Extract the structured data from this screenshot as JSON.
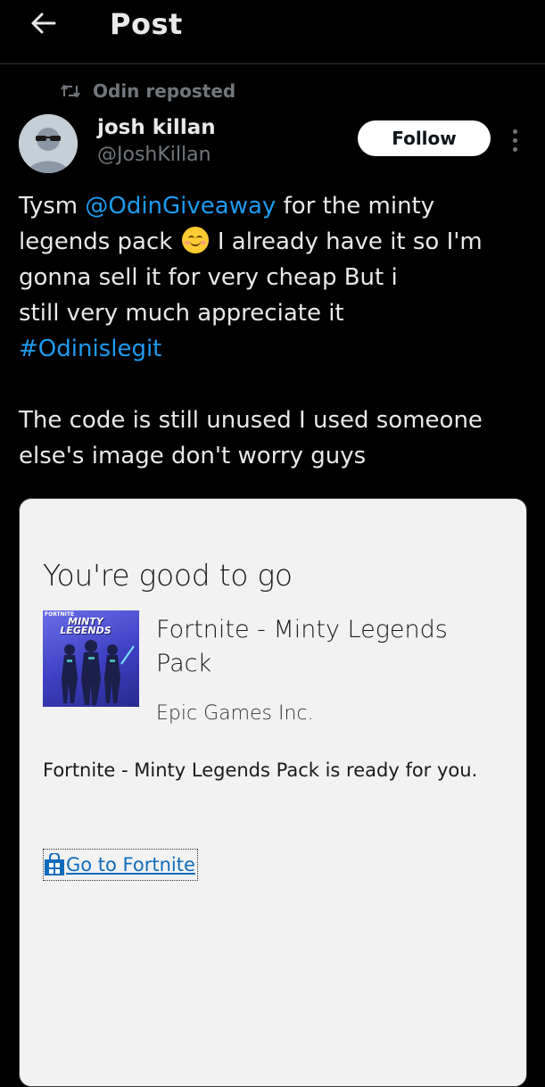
{
  "header": {
    "title": "Post"
  },
  "post": {
    "repost_label": "Odin reposted",
    "author": {
      "name": "josh killan",
      "handle": "@JoshKillan"
    },
    "follow_label": "Follow",
    "text": {
      "line1_pre": "Tysm ",
      "mention": "@OdinGiveaway",
      "line1_post": " for the minty",
      "line2_pre": "legends pack ",
      "line2_post": " I already have it so I'm",
      "line3": "gonna sell it for very cheap But i",
      "line4": " still very much appreciate it",
      "hashtag": "#Odinislegit",
      "line6": "The code is still unused I used someone",
      "line7": "else's image don't worry guys"
    }
  },
  "store_card": {
    "heading": "You're good to go",
    "product_brand": "FORTNITE",
    "product_pack_logo": "MINTY LEGENDS",
    "product_title": "Fortnite - Minty Legends Pack",
    "publisher": "Epic Games Inc.",
    "ready_message": "Fortnite - Minty Legends Pack is ready for you.",
    "go_link": "Go to Fortnite"
  },
  "colors": {
    "background": "#000000",
    "link": "#1d9bf0",
    "secondary_text": "#71767b",
    "card_background": "#f2f2f2",
    "store_link": "#0f6cbd"
  }
}
